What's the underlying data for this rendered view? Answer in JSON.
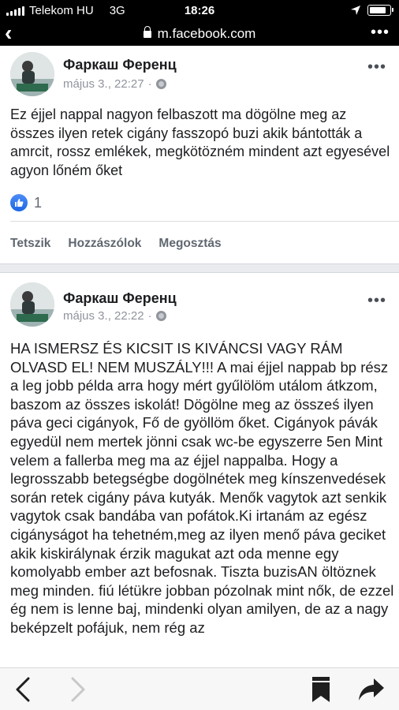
{
  "status_bar": {
    "carrier": "Telekom HU",
    "network": "3G",
    "time": "18:26",
    "battery_level": 0.85
  },
  "browser": {
    "url": "m.facebook.com",
    "more_icon": "more-dots-icon"
  },
  "posts": [
    {
      "author": "Фаркаш Ференц",
      "timestamp": "május 3., 22:27",
      "separator": "·",
      "text": "Ez éjjel nappal nagyon felbaszott ma dögölne meg az összes ilyen retek cigány fasszopó buzi akik bántották a amrcit, rossz emlékek, megkötözném mindent azt egyesével agyon lőném őket",
      "like_count": "1",
      "actions": {
        "like": "Tetszik",
        "comment": "Hozzászólok",
        "share": "Megosztás"
      }
    },
    {
      "author": "Фаркаш Ференц",
      "timestamp": "május 3., 22:22",
      "separator": "·",
      "text": "HA ISMERSZ ÉS KICSIT IS KIVÁNCSI VAGY RÁM OLVASD EL! NEM MUSZÁLY!!! A mai éjjel nappab bp rész a leg jobb példa arra hogy mért gyűlölöm utálom átkzom, baszom az összes iskolát! Dögölne meg az össześ ilyen páva geci cigányok, Fő de gyöllöm őket. Cigányok pávák egyedül nem mertek jönni csak wc-be egyszerre 5en Mint velem a fallerba meg ma az éjjel nappalba. Hogy a legrosszabb betegségbe dogölnétek meg kínszenvedések során retek cigány páva kutyák. Menők vagytok azt senkik vagytok csak bandába van pofátok.Ki irtanám az egész cigányságot ha tehetném,meg az ilyen menő páva geciket akik kiskirálynak érzik magukat azt oda menne egy komolyabb ember azt befosnak. Tiszta buzisAN öltöznek meg minden. fiú létükre jobban pózolnak mint nők, de ezzel ég nem is lenne baj, mindenki olyan amilyen, de az a nagy beképzelt pofájuk, nem rég az"
    }
  ],
  "toolbar": {
    "back_icon": "back-arrow-icon",
    "forward_icon": "forward-arrow-icon",
    "bookmark_icon": "bookmark-icon",
    "share_icon": "share-icon"
  }
}
